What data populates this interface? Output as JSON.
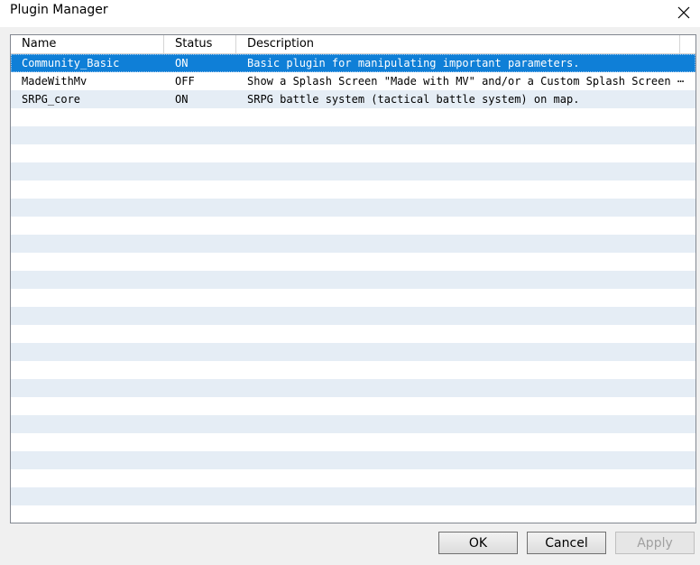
{
  "window": {
    "title": "Plugin Manager",
    "close_icon": "close-icon"
  },
  "table": {
    "columns": [
      "Name",
      "Status",
      "Description"
    ],
    "rows": [
      {
        "name": "Community_Basic",
        "status": "ON",
        "description": "Basic plugin for manipulating important parameters.",
        "selected": true
      },
      {
        "name": "MadeWithMv",
        "status": "OFF",
        "description": "Show a Splash Screen \"Made with MV\" and/or a Custom Splash Screen ⋯",
        "selected": false
      },
      {
        "name": "SRPG_core",
        "status": "ON",
        "description": "SRPG battle system (tactical battle system) on map.",
        "selected": false
      }
    ],
    "selection_color": "#0f7fd7",
    "stripe_color": "#e5edf5"
  },
  "buttons": {
    "ok": "OK",
    "cancel": "Cancel",
    "apply": "Apply"
  }
}
